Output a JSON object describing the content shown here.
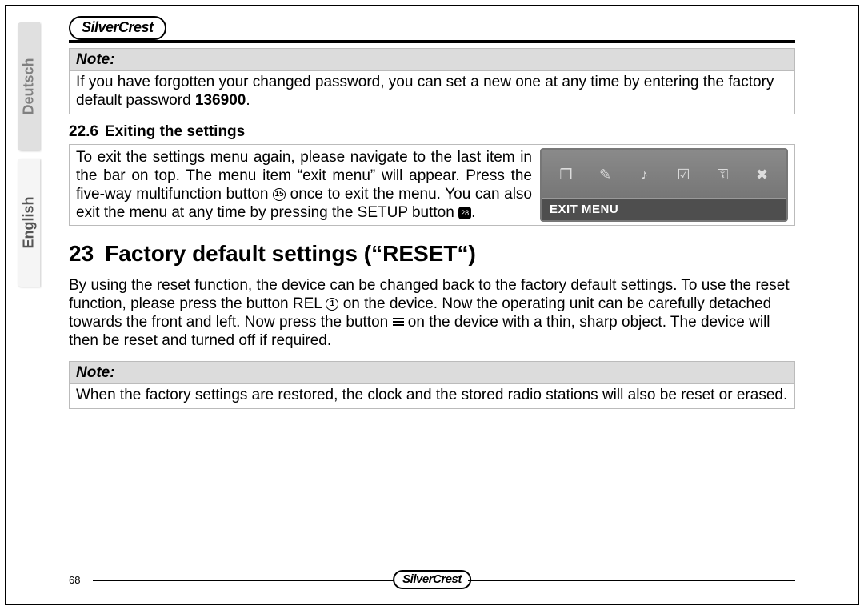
{
  "brand": "SilverCrest",
  "langs": {
    "deutsch": "Deutsch",
    "english": "English"
  },
  "page_number": "68",
  "note1": {
    "title": "Note:",
    "body_pre": "If you have forgotten your changed password, you can set a new one at any time by entering the factory default password ",
    "pw": "136900",
    "body_post": "."
  },
  "sec_226": {
    "num": "22.6",
    "title": "Exiting the settings",
    "text_pre": "To exit the settings menu again, please navigate to the last item in the bar on top. The menu item “exit menu” will appear. Press the five-way multifunction button ",
    "btn15": "15",
    "text_mid": " once to exit the menu. You can also exit the menu at any time by pressing the SETUP button ",
    "btn28": "28",
    "text_post": ".",
    "exit_menu_label": "EXIT MENU",
    "icons": {
      "monitor": "❒",
      "pen": "✎",
      "note": "♪",
      "check": "☑",
      "lock": "⚿",
      "x": "✖"
    }
  },
  "chapter23": {
    "num": "23",
    "title": "Factory default settings (“RESET“)",
    "p_pre": "By using the reset function, the device can be changed back to the factory default settings. To use the reset function, please press the button REL ",
    "btn1": "1",
    "p_mid": " on the device. Now the operating unit can be carefully detached towards the front and left. Now press the button ",
    "p_post": " on the device with a thin, sharp object. The device will then be reset and turned off if required."
  },
  "note2": {
    "title": "Note:",
    "body": "When the factory settings are restored, the clock and the stored radio stations will also be reset or erased."
  }
}
